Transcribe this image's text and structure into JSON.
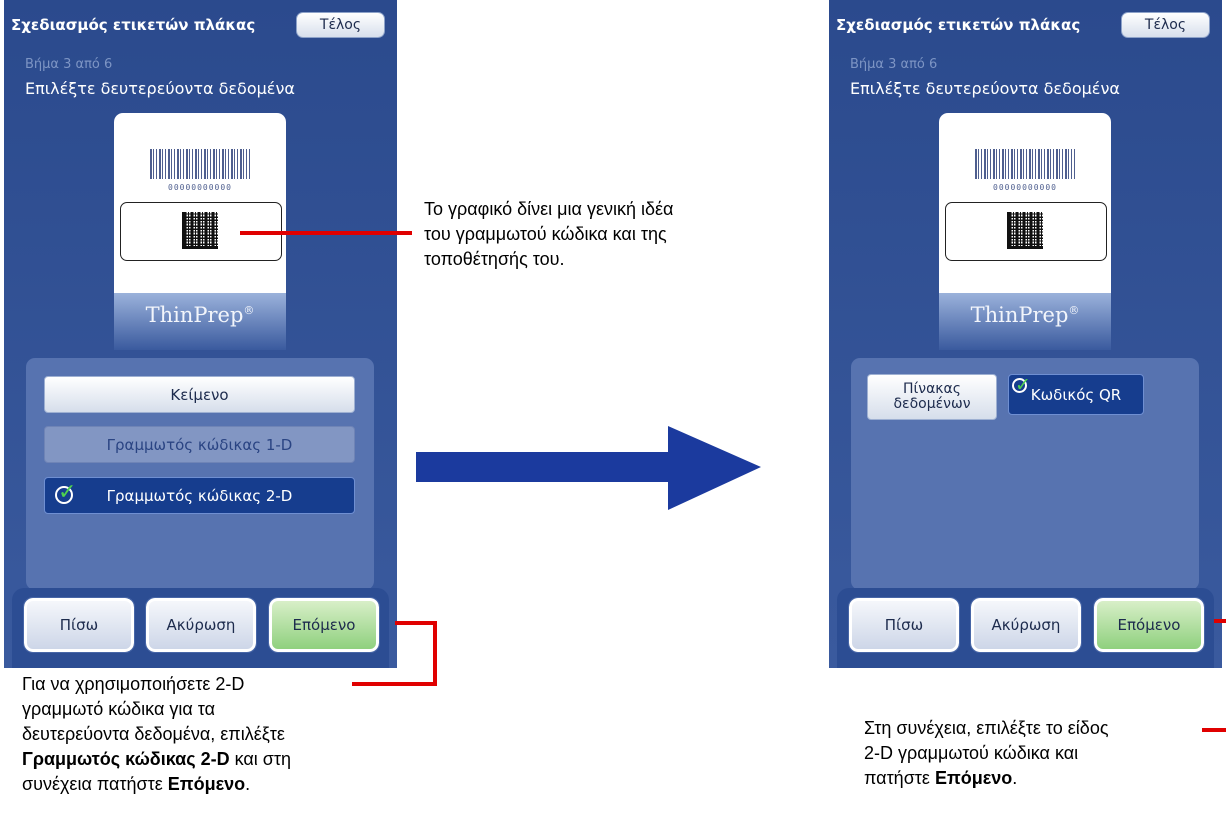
{
  "screens": [
    {
      "title": "Σχεδιασμός ετικετών πλάκας",
      "done_label": "Τέλος",
      "step": "Βήμα 3 από 6",
      "instruction": "Επιλέξτε δευτερεύοντα δεδομένα",
      "barcode_digits": "00000000000",
      "brand": "ThinPrep",
      "brand_mark": "®",
      "options": [
        {
          "label": "Κείμενο",
          "state": "normal"
        },
        {
          "label": "Γραμμωτός κώδικας 1-D",
          "state": "disabled"
        },
        {
          "label": "Γραμμωτός κώδικας 2-D",
          "state": "selected"
        }
      ],
      "buttons": {
        "back": "Πίσω",
        "cancel": "Ακύρωση",
        "next": "Επόμενο"
      }
    },
    {
      "title": "Σχεδιασμός ετικετών πλάκας",
      "done_label": "Τέλος",
      "step": "Βήμα 3 από 6",
      "instruction": "Επιλέξτε δευτερεύοντα δεδομένα",
      "barcode_digits": "00000000000",
      "brand": "ThinPrep",
      "brand_mark": "®",
      "options": [
        {
          "label_line1": "Πίνακας",
          "label_line2": "δεδομένων",
          "state": "normal"
        },
        {
          "label": "Κωδικός QR",
          "state": "selected"
        }
      ],
      "buttons": {
        "back": "Πίσω",
        "cancel": "Ακύρωση",
        "next": "Επόμενο"
      }
    }
  ],
  "callouts": {
    "graphic": [
      "Το γραφικό δίνει μια γενική ιδέα",
      "του γραμμωτού κώδικα και της",
      "τοποθέτησής του."
    ],
    "left_note": {
      "line1": "Για να χρησιμοποιήσετε 2-D",
      "line2": "γραμμωτό κώδικα για τα",
      "line3": "δευτερεύοντα δεδομένα, επιλέξτε",
      "bold1": "Γραμμωτός κώδικας 2-D",
      "after_bold1": " και στη",
      "line5_pre": "συνέχεια πατήστε ",
      "bold2": "Επόμενο",
      "end": "."
    },
    "right_note": {
      "line1": "Στη συνέχεια, επιλέξτε το είδος",
      "line2": "2-D γραμμωτού κώδικα και",
      "line3_pre": "πατήστε ",
      "bold": "Επόμενο",
      "end": "."
    }
  },
  "colors": {
    "annotation_line": "#e00000",
    "arrow": "#1b3a9e",
    "screen_bg": "#2b4a8d",
    "next_button": "#8fd07e"
  }
}
